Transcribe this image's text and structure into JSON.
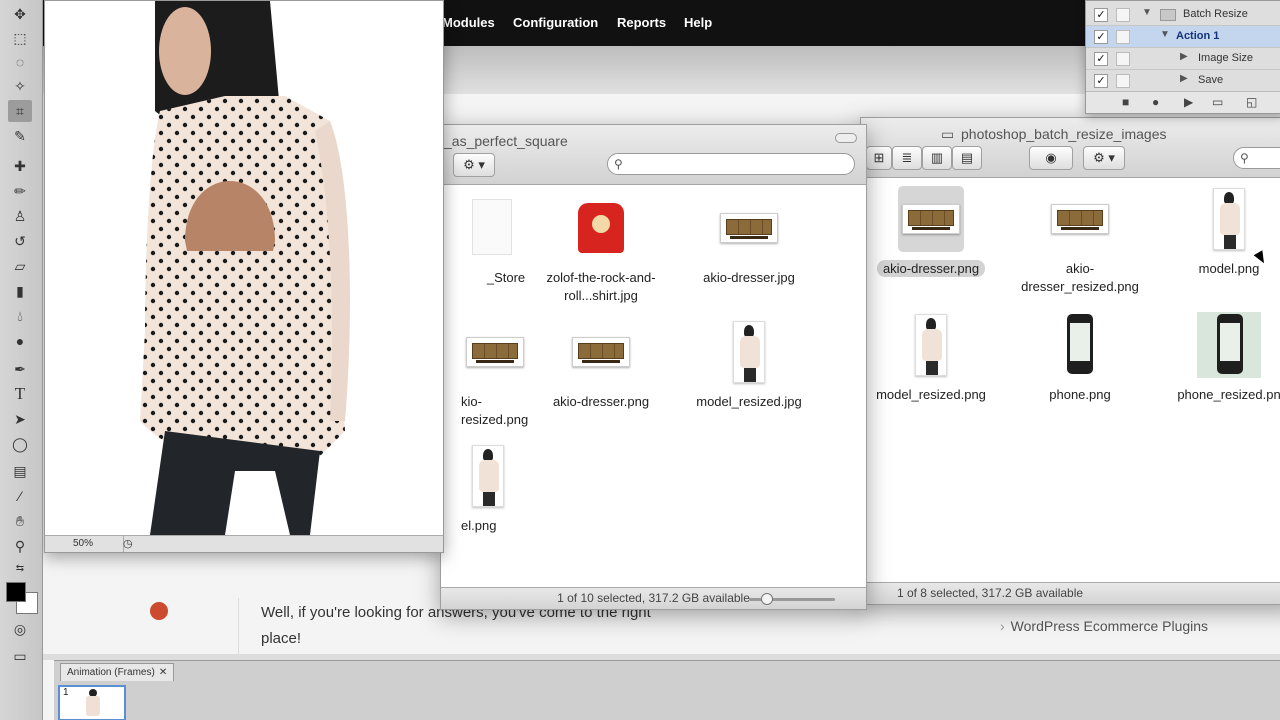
{
  "web": {
    "nav": [
      "Modules",
      "Configuration",
      "Reports",
      "Help"
    ],
    "body_text": "Well, if you're looking for answers, you've come to the right place!",
    "sidebar_link": "WordPress Ecommerce Plugins"
  },
  "finder_left": {
    "title": "_as_perfect_square",
    "status": "1 of 10 selected, 317.2 GB available",
    "files": [
      {
        "label": "_Store",
        "kind": "doc"
      },
      {
        "label": "zolof-the-rock-and-roll...shirt.jpg",
        "kind": "shirt"
      },
      {
        "label": "akio-dresser.jpg",
        "kind": "dresser"
      },
      {
        "label": "kio-\nresized.png",
        "kind": "dresser"
      },
      {
        "label": "akio-dresser.png",
        "kind": "dresser"
      },
      {
        "label": "model_resized.jpg",
        "kind": "model"
      },
      {
        "label": "el.png",
        "kind": "model"
      }
    ]
  },
  "finder_right": {
    "title": "photoshop_batch_resize_images",
    "status": "1 of 8 selected, 317.2 GB available",
    "files": [
      {
        "label": "akio-dresser.png",
        "kind": "dresser",
        "selected": true
      },
      {
        "label": "akio-\ndresser_resized.png",
        "kind": "dresser"
      },
      {
        "label": "model.png",
        "kind": "model"
      },
      {
        "label": "model_resized.png",
        "kind": "model"
      },
      {
        "label": "phone.png",
        "kind": "phone"
      },
      {
        "label": "phone_resized.pn",
        "kind": "phone"
      }
    ]
  },
  "photoshop": {
    "zoom": "50%",
    "actions": [
      {
        "label": "Batch Resize",
        "level": 0,
        "kind": "folder"
      },
      {
        "label": "Action 1",
        "level": 1,
        "selected": true
      },
      {
        "label": "Image Size",
        "level": 2
      },
      {
        "label": "Save",
        "level": 2
      }
    ],
    "animation_tab": "Animation (Frames)",
    "frame_number": "1"
  },
  "colors": {
    "nav_bg": "#111111",
    "selection": "#c4d5ee",
    "accent": "#5b8fd4"
  }
}
